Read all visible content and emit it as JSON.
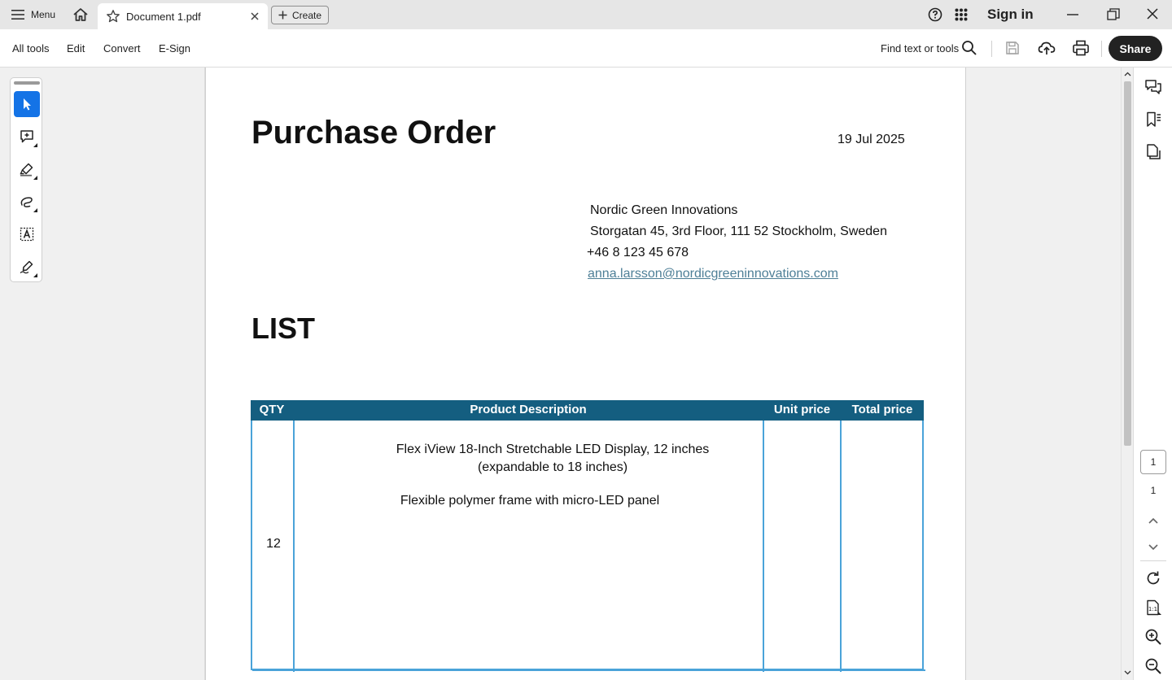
{
  "titlebar": {
    "menu_label": "Menu",
    "tab_title": "Document 1.pdf",
    "create_label": "Create",
    "signin_label": "Sign in"
  },
  "toolbar": {
    "nav": [
      "All tools",
      "Edit",
      "Convert",
      "E-Sign"
    ],
    "find_label": "Find text or tools",
    "share_label": "Share"
  },
  "document": {
    "title": "Purchase Order",
    "date": "19 Jul 2025",
    "company": "Nordic Green Innovations",
    "address": "Storgatan 45, 3rd Floor, 111 52 Stockholm, Sweden",
    "phone": "+46 8 123 45 678",
    "email": "anna.larsson@nordicgreeninnovations.com",
    "list_heading": "LIST",
    "table": {
      "headers": [
        "QTY",
        "Product Description",
        "Unit price",
        "Total price"
      ],
      "rows": [
        {
          "qty": "12",
          "description_line1": "Flex iView 18-Inch Stretchable LED Display, 12 inches",
          "description_line2": "(expandable to 18 inches)",
          "description_line3": "Flexible polymer frame with micro-LED panel",
          "unit_price": "",
          "total_price": ""
        }
      ]
    }
  },
  "pager": {
    "current_page": "1",
    "total_pages": "1"
  },
  "colors": {
    "accent": "#1473e6",
    "table_header": "#145e80",
    "table_border": "#4aa3d9",
    "link": "#4e7f97"
  }
}
